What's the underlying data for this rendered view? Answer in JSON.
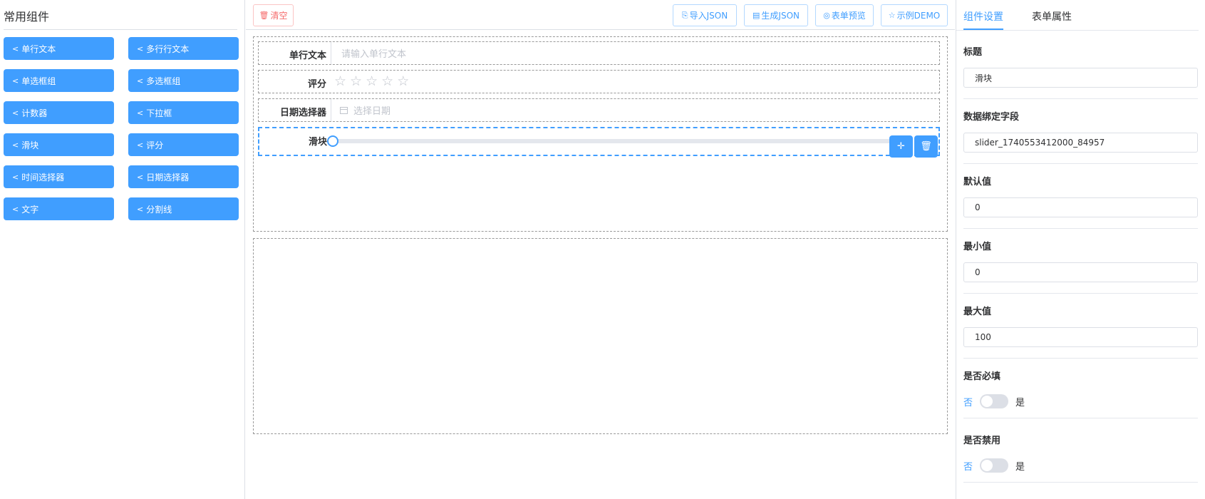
{
  "left": {
    "title": "常用组件",
    "components": [
      {
        "label": "单行文本",
        "icon": "share-icon"
      },
      {
        "label": "多行行文本",
        "icon": "share-icon"
      },
      {
        "label": "单选框组",
        "icon": "share-icon"
      },
      {
        "label": "多选框组",
        "icon": "share-icon"
      },
      {
        "label": "计数器",
        "icon": "share-icon"
      },
      {
        "label": "下拉框",
        "icon": "share-icon"
      },
      {
        "label": "滑块",
        "icon": "share-icon"
      },
      {
        "label": "评分",
        "icon": "share-icon"
      },
      {
        "label": "时间选择器",
        "icon": "share-icon"
      },
      {
        "label": "日期选择器",
        "icon": "share-icon"
      },
      {
        "label": "文字",
        "icon": "share-icon"
      },
      {
        "label": "分割线",
        "icon": "share-icon"
      }
    ]
  },
  "toolbar": {
    "clear": "清空",
    "import_json": "导入JSON",
    "generate_json": "生成JSON",
    "preview": "表单预览",
    "demo": "示例DEMO"
  },
  "form": {
    "rows": [
      {
        "label": "单行文本",
        "placeholder": "请输入单行文本"
      },
      {
        "label": "评分",
        "stars": 5,
        "value": 0
      },
      {
        "label": "日期选择器",
        "placeholder": "选择日期"
      },
      {
        "label": "滑块",
        "value": 0,
        "min": 0,
        "max": 100
      }
    ]
  },
  "right": {
    "tabs": [
      "组件设置",
      "表单属性"
    ],
    "title_label": "标题",
    "title_value": "滑块",
    "field_label": "数据绑定字段",
    "field_value": "slider_1740553412000_84957",
    "default_label": "默认值",
    "default_value": "0",
    "min_label": "最小值",
    "min_value": "0",
    "max_label": "最大值",
    "max_value": "100",
    "required_label": "是否必填",
    "disabled_label": "是否禁用",
    "switch_off": "否",
    "switch_on": "是"
  },
  "colors": {
    "accent": "#409eff",
    "danger": "#f56c6c"
  }
}
